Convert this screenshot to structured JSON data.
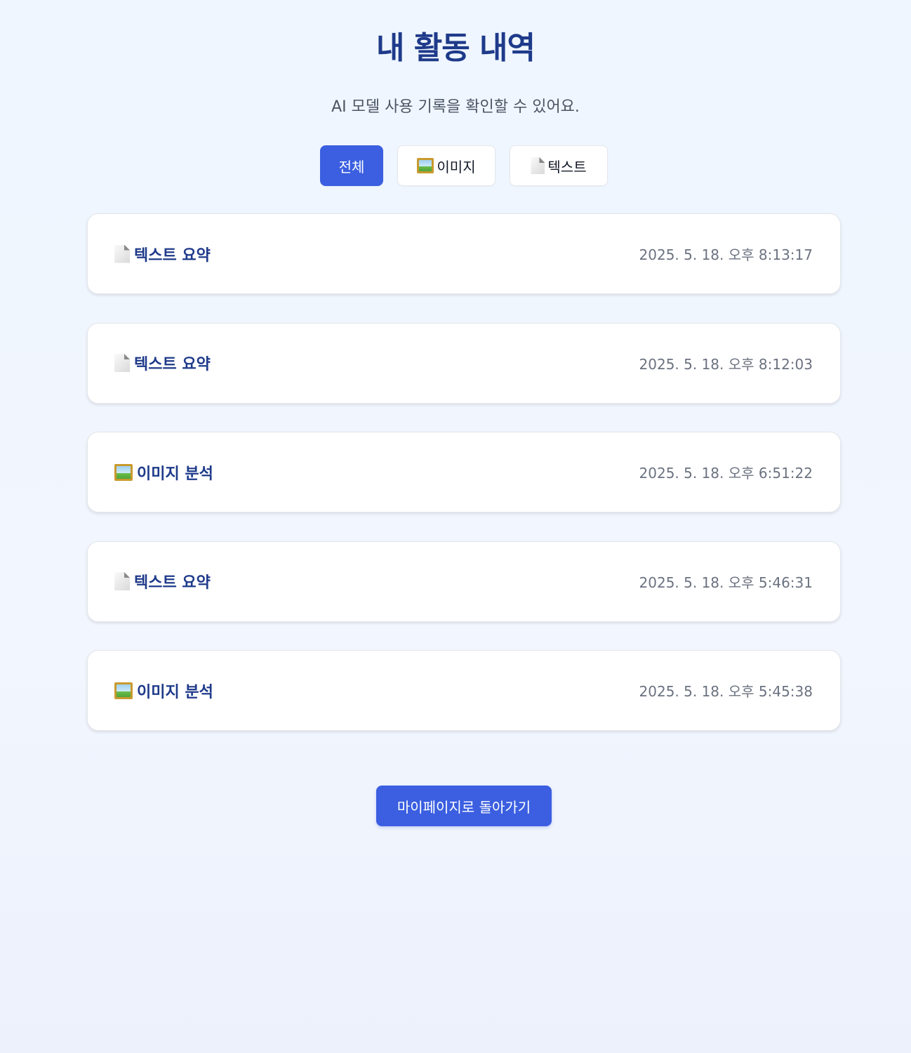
{
  "header": {
    "title": "내 활동 내역",
    "subtitle": "AI 모델 사용 기록을 확인할 수 있어요."
  },
  "filters": {
    "all_label": "전체",
    "image_label": "이미지",
    "text_label": "텍스트",
    "active": "전체"
  },
  "activities": [
    {
      "icon": "document-icon",
      "title": "텍스트 요약",
      "time": "2025. 5. 18. 오후 8:13:17"
    },
    {
      "icon": "document-icon",
      "title": "텍스트 요약",
      "time": "2025. 5. 18. 오후 8:12:03"
    },
    {
      "icon": "picture-icon",
      "title": "이미지 분석",
      "time": "2025. 5. 18. 오후 6:51:22"
    },
    {
      "icon": "document-icon",
      "title": "텍스트 요약",
      "time": "2025. 5. 18. 오후 5:46:31"
    },
    {
      "icon": "picture-icon",
      "title": "이미지 분석",
      "time": "2025. 5. 18. 오후 5:45:38"
    }
  ],
  "footer": {
    "back_label": "마이페이지로 돌아가기"
  },
  "colors": {
    "accent": "#3b5fe0",
    "title": "#1e3a8a",
    "background": "#eff6ff"
  }
}
